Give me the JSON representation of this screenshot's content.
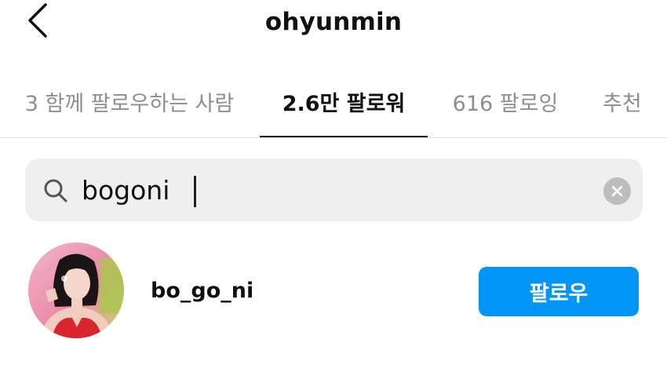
{
  "header": {
    "title": "ohyunmin",
    "back_icon": "chevron-left-icon"
  },
  "tabs": [
    {
      "label": "3 함께 팔로우하는 사람",
      "active": false
    },
    {
      "label": "2.6만 팔로워",
      "active": true
    },
    {
      "label": "616 팔로잉",
      "active": false
    },
    {
      "label": "추천",
      "active": false
    }
  ],
  "search": {
    "value": "bogoni",
    "icon": "search-icon",
    "clear_icon": "clear-icon"
  },
  "results": [
    {
      "username": "bo_go_ni",
      "avatar": "avatar-photo",
      "follow_label": "팔로우"
    }
  ],
  "colors": {
    "accent": "#0095f6",
    "search_bg": "#efefef",
    "inactive_text": "#8e8e8e",
    "text": "#111111"
  }
}
